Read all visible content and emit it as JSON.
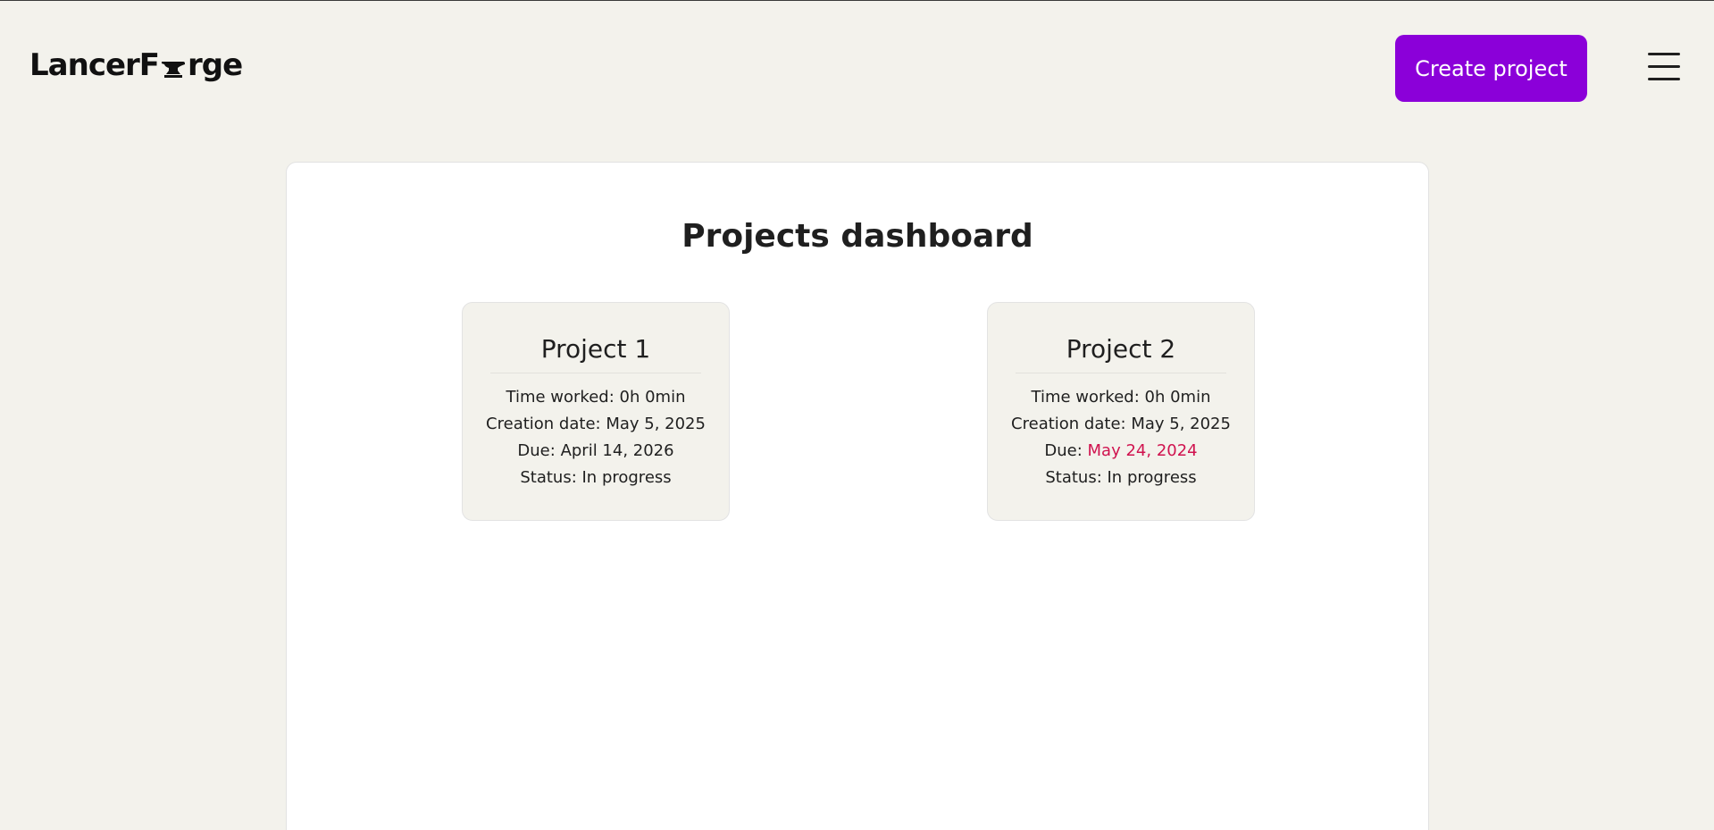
{
  "header": {
    "logo_left": "LancerF",
    "logo_right": "rge",
    "create_button_label": "Create project",
    "menu_icon": "hamburger-menu-icon"
  },
  "dashboard": {
    "title": "Projects dashboard",
    "projects": [
      {
        "name": "Project 1",
        "time_worked_label": "Time worked:",
        "time_worked": "0h 0min",
        "creation_label": "Creation date:",
        "creation_date": "May 5, 2025",
        "due_label": "Due:",
        "due_date": "April 14, 2026",
        "due_overdue": false,
        "status_label": "Status:",
        "status": "In progress"
      },
      {
        "name": "Project 2",
        "time_worked_label": "Time worked:",
        "time_worked": "0h 0min",
        "creation_label": "Creation date:",
        "creation_date": "May 5, 2025",
        "due_label": "Due:",
        "due_date": "May 24, 2024",
        "due_overdue": true,
        "status_label": "Status:",
        "status": "In progress"
      }
    ]
  },
  "colors": {
    "background": "#f3f2ec",
    "accent": "#8b00d9",
    "overdue": "#d0134f"
  }
}
